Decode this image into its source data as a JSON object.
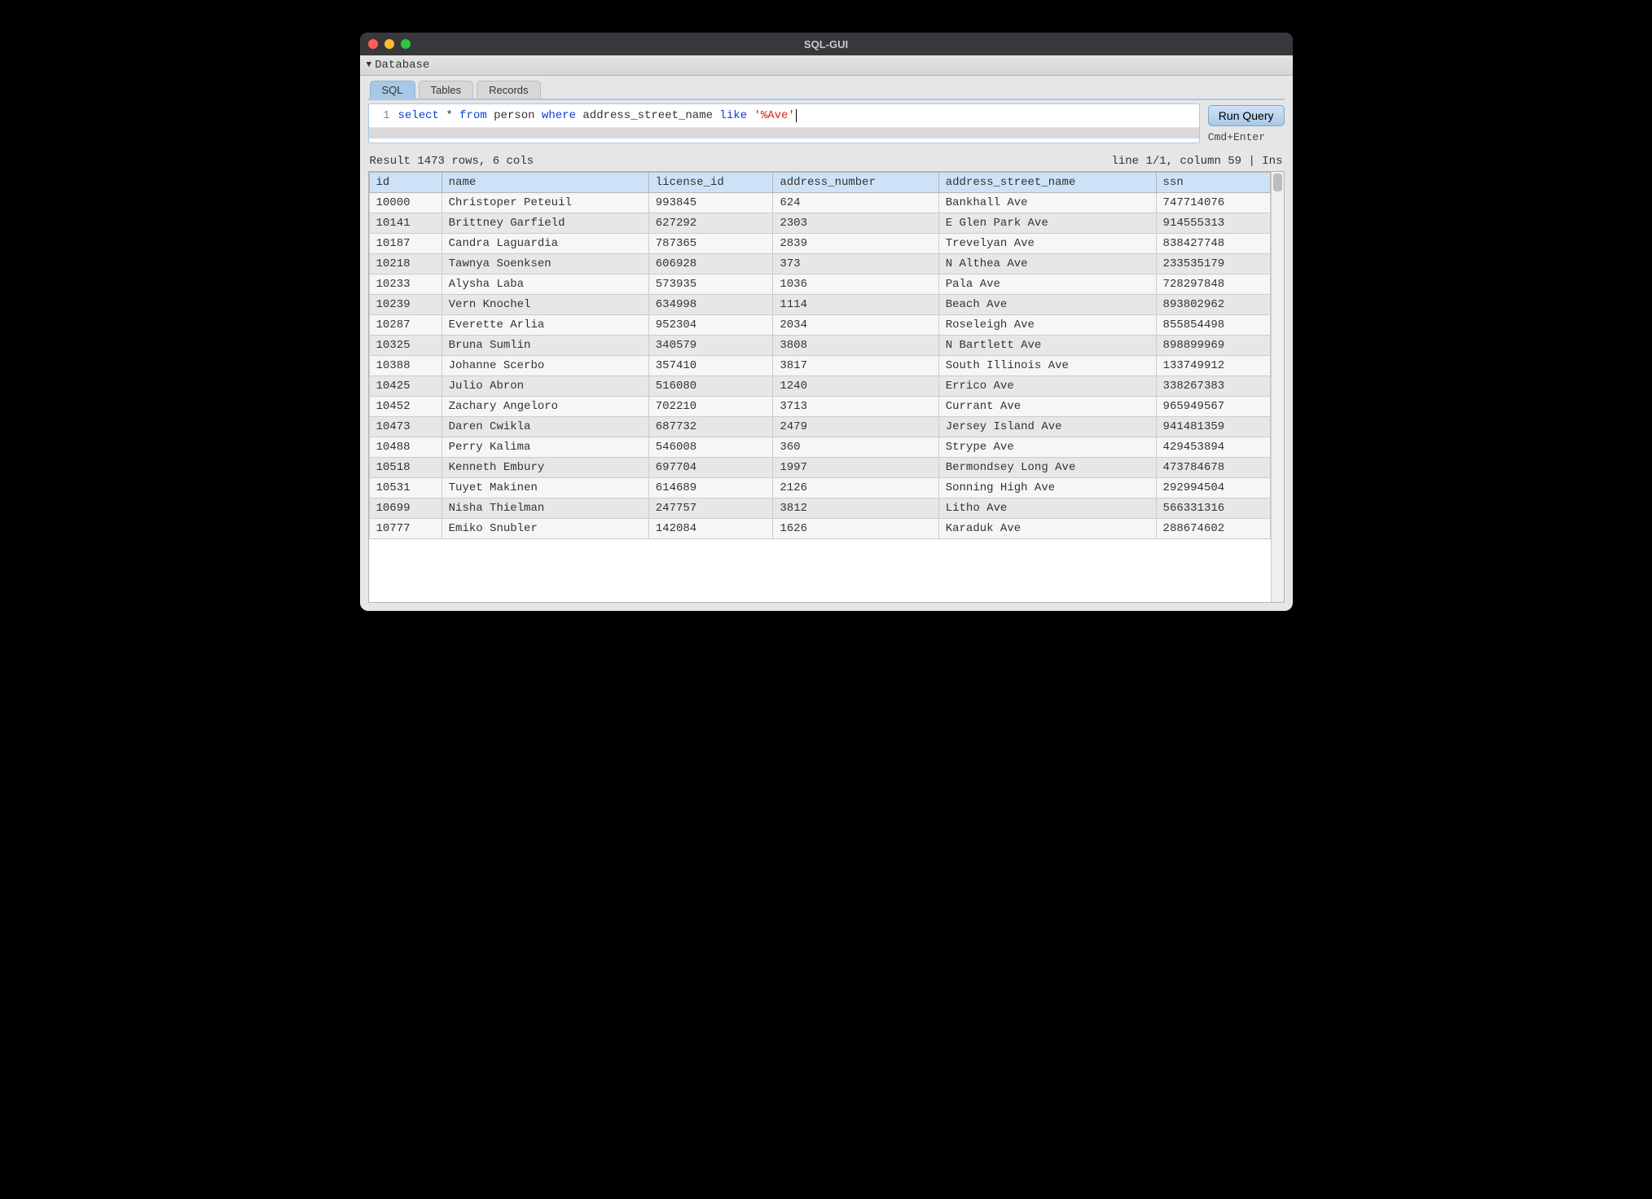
{
  "window": {
    "title": "SQL-GUI"
  },
  "menubar": {
    "database_label": "Database"
  },
  "tabs": {
    "items": [
      {
        "label": "SQL",
        "active": true
      },
      {
        "label": "Tables",
        "active": false
      },
      {
        "label": "Records",
        "active": false
      }
    ]
  },
  "editor": {
    "line_number": "1",
    "tokens": [
      {
        "t": "select",
        "c": "kw"
      },
      {
        "t": " * ",
        "c": ""
      },
      {
        "t": "from",
        "c": "kw"
      },
      {
        "t": " person ",
        "c": ""
      },
      {
        "t": "where",
        "c": "kw"
      },
      {
        "t": " address_street_name ",
        "c": ""
      },
      {
        "t": "like",
        "c": "kw"
      },
      {
        "t": " ",
        "c": ""
      },
      {
        "t": "'%Ave'",
        "c": "str"
      }
    ]
  },
  "run": {
    "button_label": "Run Query",
    "shortcut": "Cmd+Enter"
  },
  "status": {
    "left": "Result 1473 rows, 6 cols",
    "right": "line 1/1, column 59 | Ins"
  },
  "table": {
    "columns": [
      "id",
      "name",
      "license_id",
      "address_number",
      "address_street_name",
      "ssn"
    ],
    "rows": [
      [
        "10000",
        "Christoper Peteuil",
        "993845",
        "624",
        "Bankhall Ave",
        "747714076"
      ],
      [
        "10141",
        "Brittney Garfield",
        "627292",
        "2303",
        "E Glen Park Ave",
        "914555313"
      ],
      [
        "10187",
        "Candra Laguardia",
        "787365",
        "2839",
        "Trevelyan Ave",
        "838427748"
      ],
      [
        "10218",
        "Tawnya Soenksen",
        "606928",
        "373",
        "N Althea Ave",
        "233535179"
      ],
      [
        "10233",
        "Alysha Laba",
        "573935",
        "1036",
        "Pala Ave",
        "728297848"
      ],
      [
        "10239",
        "Vern Knochel",
        "634998",
        "1114",
        "Beach Ave",
        "893802962"
      ],
      [
        "10287",
        "Everette Arlia",
        "952304",
        "2034",
        "Roseleigh Ave",
        "855854498"
      ],
      [
        "10325",
        "Bruna Sumlin",
        "340579",
        "3808",
        "N Bartlett Ave",
        "898899969"
      ],
      [
        "10388",
        "Johanne Scerbo",
        "357410",
        "3817",
        "South Illinois Ave",
        "133749912"
      ],
      [
        "10425",
        "Julio Abron",
        "516080",
        "1240",
        "Errico Ave",
        "338267383"
      ],
      [
        "10452",
        "Zachary Angeloro",
        "702210",
        "3713",
        "Currant Ave",
        "965949567"
      ],
      [
        "10473",
        "Daren Cwikla",
        "687732",
        "2479",
        "Jersey Island Ave",
        "941481359"
      ],
      [
        "10488",
        "Perry Kalima",
        "546008",
        "360",
        "Strype Ave",
        "429453894"
      ],
      [
        "10518",
        "Kenneth Embury",
        "697704",
        "1997",
        "Bermondsey Long Ave",
        "473784678"
      ],
      [
        "10531",
        "Tuyet Makinen",
        "614689",
        "2126",
        "Sonning High Ave",
        "292994504"
      ],
      [
        "10699",
        "Nisha Thielman",
        "247757",
        "3812",
        "Litho Ave",
        "566331316"
      ],
      [
        "10777",
        "Emiko Snubler",
        "142084",
        "1626",
        "Karaduk Ave",
        "288674602"
      ]
    ]
  }
}
